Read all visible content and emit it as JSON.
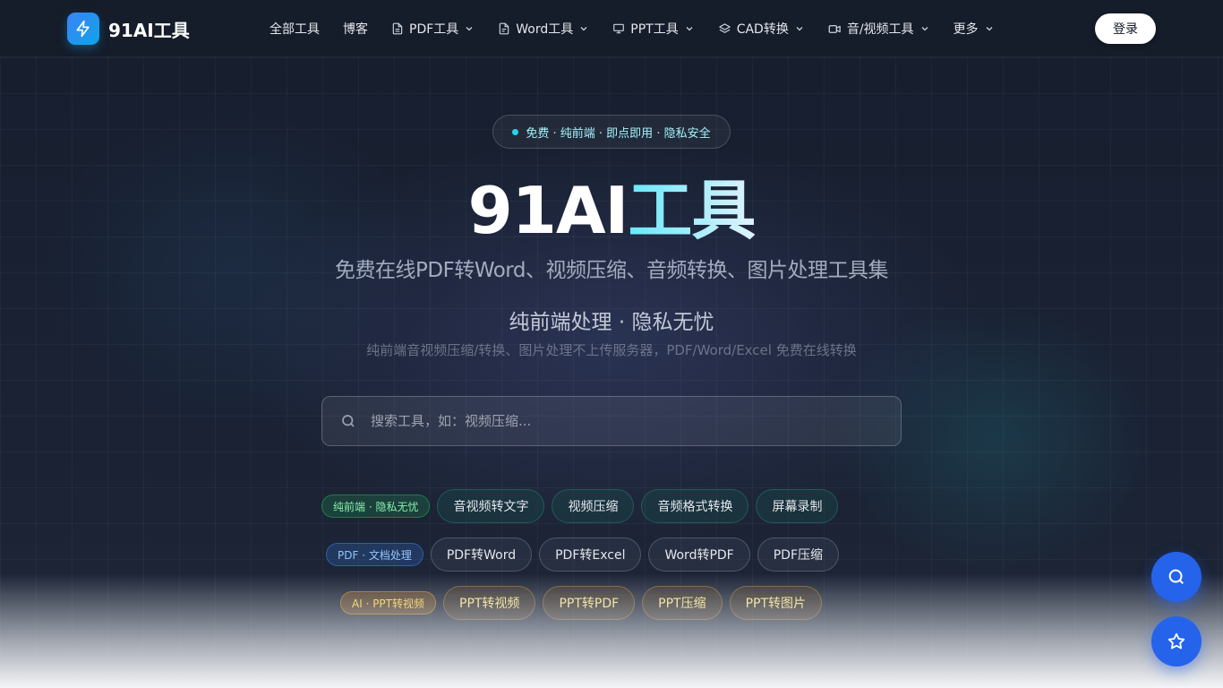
{
  "header": {
    "logo_text": "91AI工具",
    "nav": [
      {
        "label": "全部工具"
      },
      {
        "label": "博客"
      },
      {
        "label": "PDF工具"
      },
      {
        "label": "Word工具"
      },
      {
        "label": "PPT工具"
      },
      {
        "label": "CAD转换"
      },
      {
        "label": "音/视频工具"
      },
      {
        "label": "更多"
      }
    ],
    "login_label": "登录"
  },
  "hero": {
    "badge": "免费 · 纯前端 · 即点即用 · 隐私安全",
    "title_part1": "91AI",
    "title_part2": "工具",
    "subtitle": "免费在线PDF转Word、视频压缩、音频转换、图片处理工具集",
    "tagline": "纯前端处理 · 隐私无忧",
    "description": "纯前端音视频压缩/转换、图片处理不上传服务器，PDF/Word/Excel 免费在线转换"
  },
  "search": {
    "placeholder": "搜索工具，如：视频压缩..."
  },
  "rows": [
    {
      "label": "纯前端 · 隐私无忧",
      "chips": [
        "音视频转文字",
        "视频压缩",
        "音频格式转换",
        "屏幕录制"
      ]
    },
    {
      "label": "PDF · 文档处理",
      "chips": [
        "PDF转Word",
        "PDF转Excel",
        "Word转PDF",
        "PDF压缩"
      ]
    },
    {
      "label": "AI · PPT转视频",
      "chips": [
        "PPT转视频",
        "PPT转PDF",
        "PPT压缩",
        "PPT转图片"
      ]
    }
  ],
  "colors": {
    "accent": "#2563eb",
    "logo_gradient_start": "#3b82f6",
    "logo_gradient_end": "#0ea5e9",
    "title_cyan": "#67e8f9"
  },
  "icons": {
    "logo": "lightning-icon",
    "fab_top": "search-icon",
    "fab_bottom": "star-icon"
  }
}
